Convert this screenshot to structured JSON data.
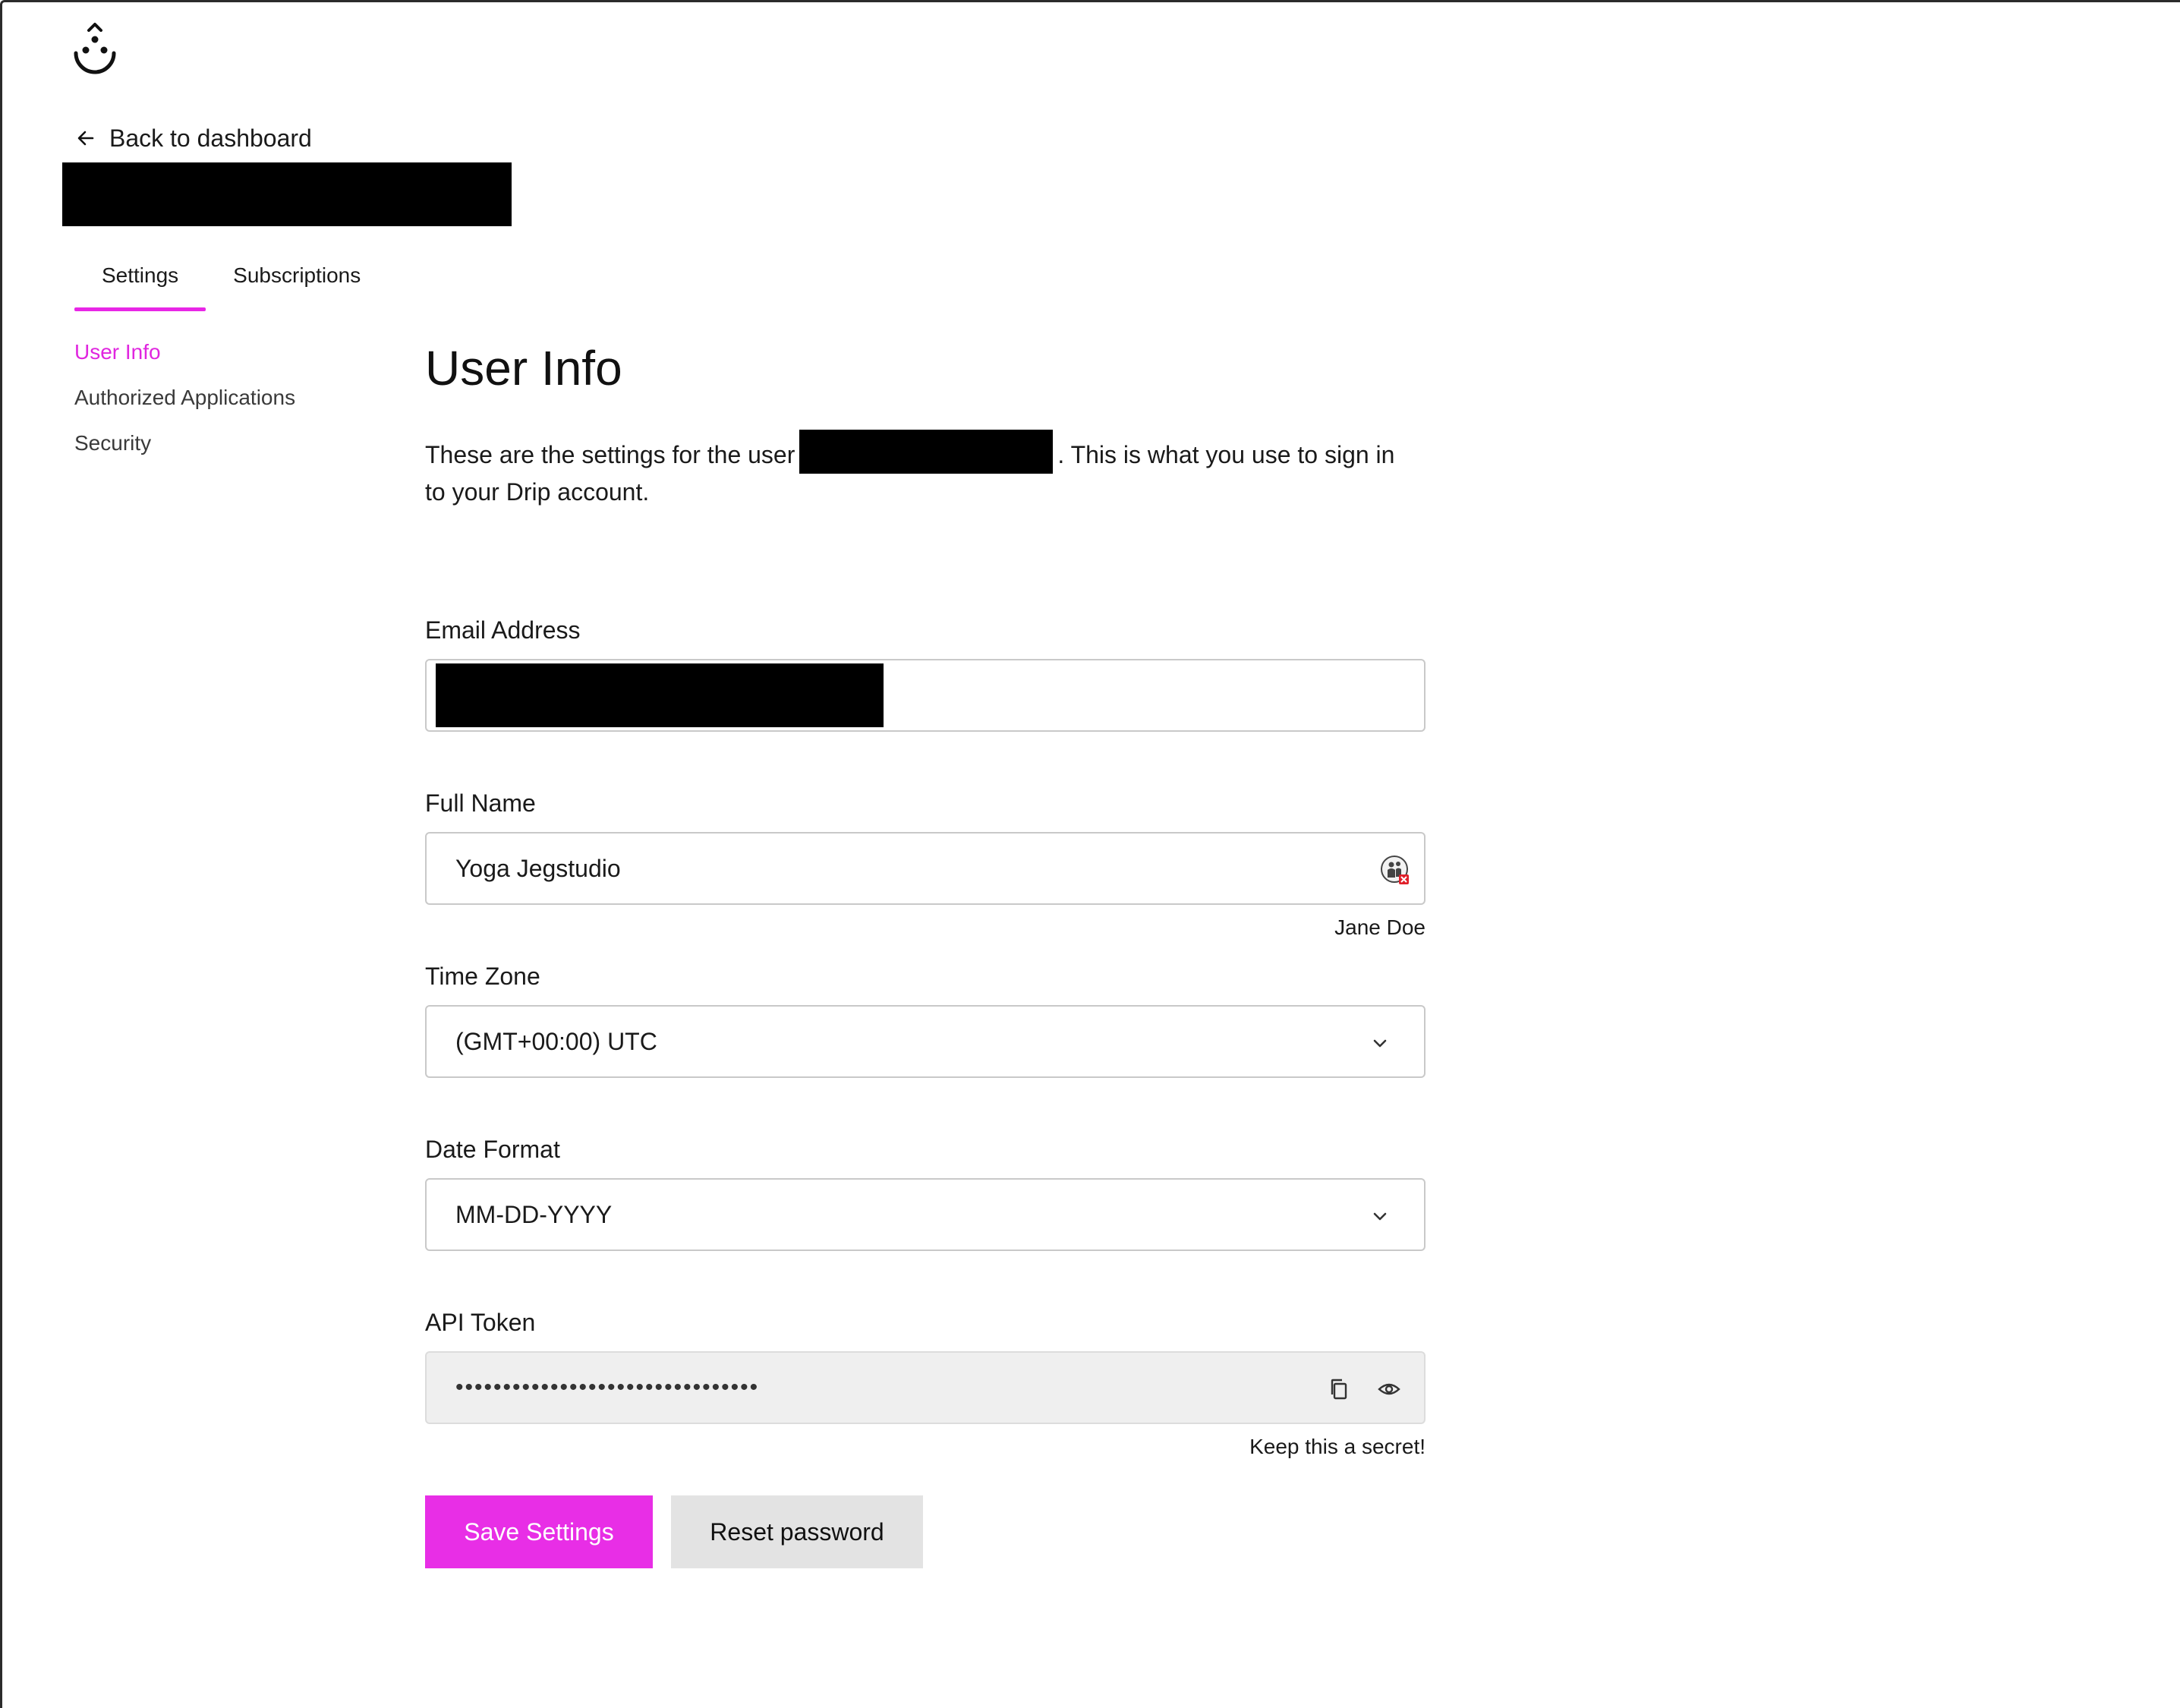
{
  "nav": {
    "back_label": "Back to dashboard"
  },
  "tabs": [
    {
      "label": "Settings",
      "active": true
    },
    {
      "label": "Subscriptions",
      "active": false
    }
  ],
  "sidebar": {
    "items": [
      {
        "label": "User Info",
        "active": true
      },
      {
        "label": "Authorized Applications",
        "active": false
      },
      {
        "label": "Security",
        "active": false
      }
    ]
  },
  "main": {
    "title": "User Info",
    "intro_before": "These are the settings for the user",
    "intro_after": ". This is what you use to sign in to your Drip account."
  },
  "form": {
    "email": {
      "label": "Email Address",
      "value": ""
    },
    "full_name": {
      "label": "Full Name",
      "value": "Yoga Jegstudio",
      "hint": "Jane Doe"
    },
    "time_zone": {
      "label": "Time Zone",
      "value": "(GMT+00:00) UTC"
    },
    "date_format": {
      "label": "Date Format",
      "value": "MM-DD-YYYY"
    },
    "api_token": {
      "label": "API Token",
      "masked_value": "••••••••••••••••••••••••••••••••",
      "hint": "Keep this a secret!"
    }
  },
  "actions": {
    "save_label": "Save Settings",
    "reset_label": "Reset password"
  },
  "colors": {
    "accent": "#e82ee6",
    "active_link": "#e026df",
    "secondary_button": "#e3e3e3",
    "redaction": "#000000"
  },
  "icons": {
    "logo": "drip-logo-icon",
    "back": "arrow-left-icon",
    "autofill": "contact-autofill-icon",
    "select": "chevron-down-icon",
    "copy": "copy-icon",
    "reveal": "eye-icon"
  }
}
